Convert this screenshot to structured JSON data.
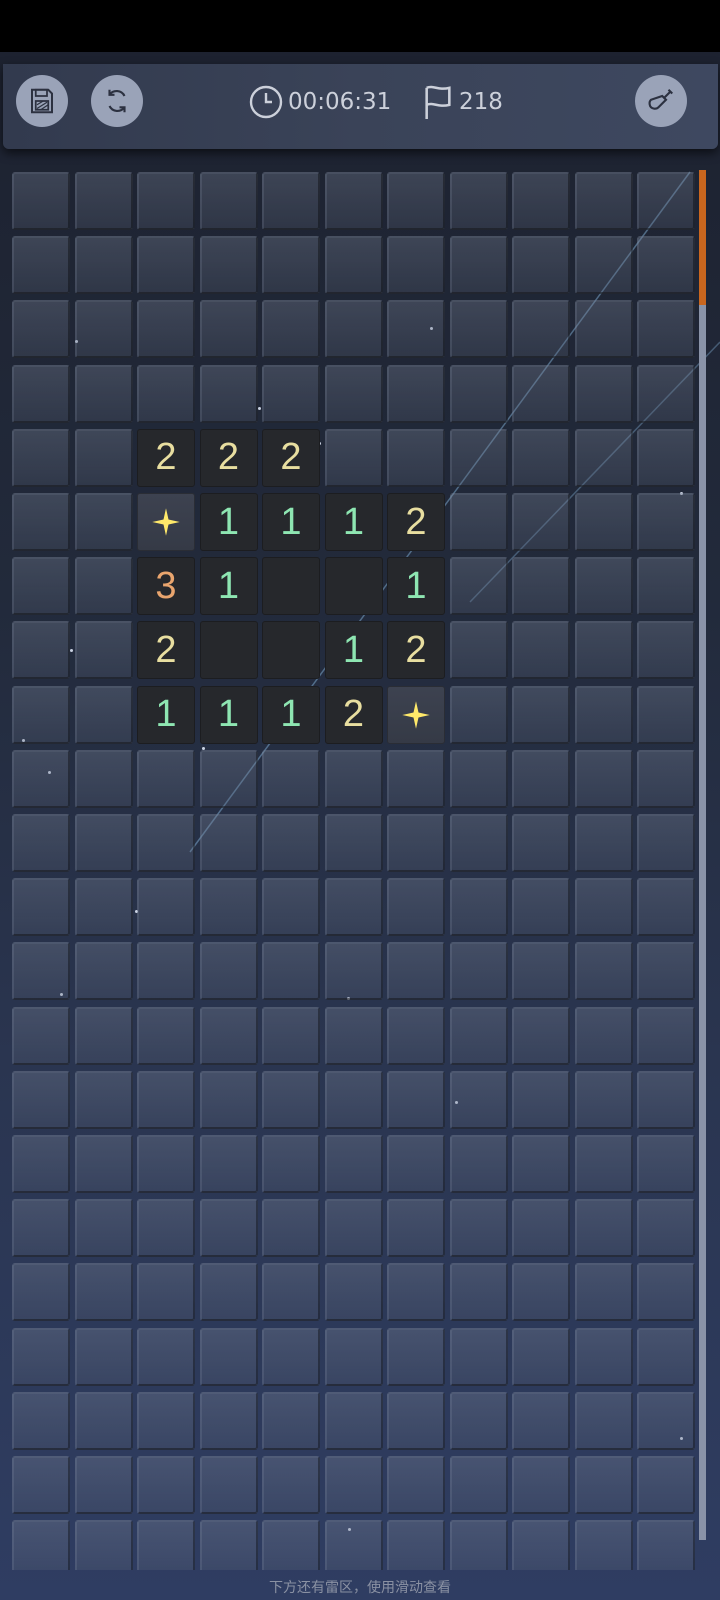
{
  "toolbar": {
    "timer": "00:06:31",
    "flag_count": "218",
    "save_icon": "save-icon",
    "restart_icon": "restart-icon",
    "shovel_icon": "shovel-icon"
  },
  "board": {
    "cols": 11,
    "rows": 22,
    "revealed": [
      {
        "r": 4,
        "c": 2,
        "v": "2"
      },
      {
        "r": 4,
        "c": 3,
        "v": "2"
      },
      {
        "r": 4,
        "c": 4,
        "v": "2"
      },
      {
        "r": 5,
        "c": 2,
        "v": "flag"
      },
      {
        "r": 5,
        "c": 3,
        "v": "1"
      },
      {
        "r": 5,
        "c": 4,
        "v": "1"
      },
      {
        "r": 5,
        "c": 5,
        "v": "1"
      },
      {
        "r": 5,
        "c": 6,
        "v": "2"
      },
      {
        "r": 6,
        "c": 2,
        "v": "3"
      },
      {
        "r": 6,
        "c": 3,
        "v": "1"
      },
      {
        "r": 6,
        "c": 4,
        "v": ""
      },
      {
        "r": 6,
        "c": 5,
        "v": ""
      },
      {
        "r": 6,
        "c": 6,
        "v": "1"
      },
      {
        "r": 7,
        "c": 2,
        "v": "2"
      },
      {
        "r": 7,
        "c": 3,
        "v": ""
      },
      {
        "r": 7,
        "c": 4,
        "v": ""
      },
      {
        "r": 7,
        "c": 5,
        "v": "1"
      },
      {
        "r": 7,
        "c": 6,
        "v": "2"
      },
      {
        "r": 8,
        "c": 2,
        "v": "1"
      },
      {
        "r": 8,
        "c": 3,
        "v": "1"
      },
      {
        "r": 8,
        "c": 4,
        "v": "1"
      },
      {
        "r": 8,
        "c": 5,
        "v": "2"
      },
      {
        "r": 8,
        "c": 6,
        "v": "flag"
      }
    ]
  },
  "colors": {
    "n1": "#8ee6b2",
    "n2": "#e8dea0",
    "n3": "#e9a56e",
    "flag": "#ffe96a",
    "scroll_thumb": "#c9661e"
  },
  "footer_hint": "下方还有雷区，使用滑动查看"
}
